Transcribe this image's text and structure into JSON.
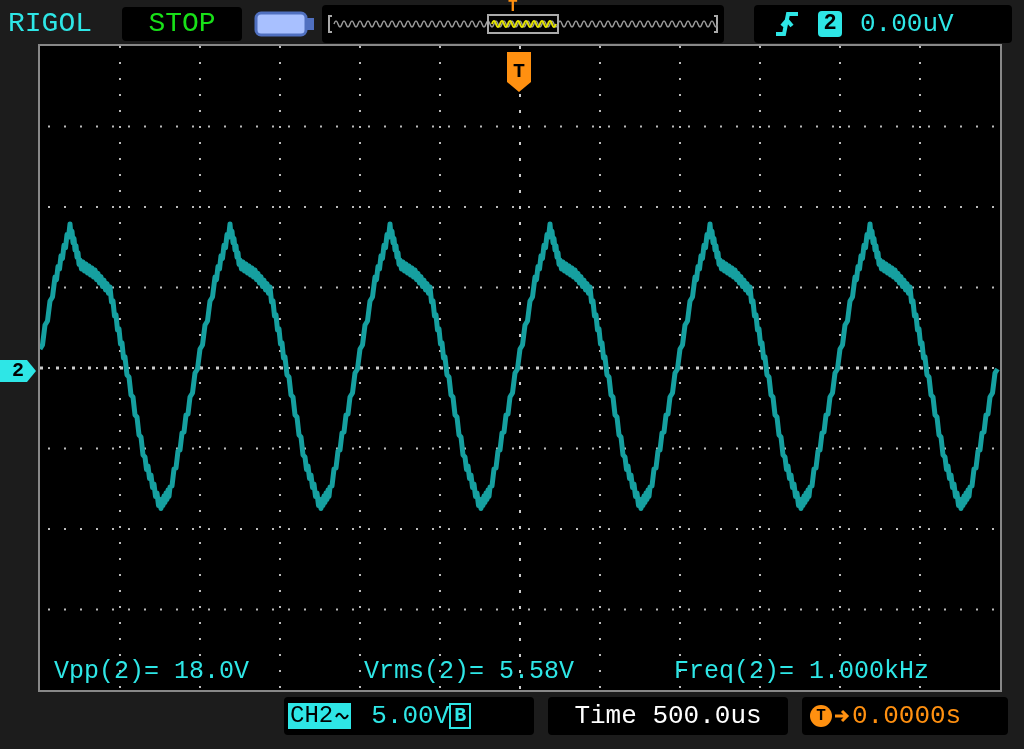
{
  "header": {
    "brand": "RIGOL",
    "run_state": "STOP",
    "timeline_marker": "T",
    "trigger": {
      "channel": "2",
      "level": "0.00uV"
    }
  },
  "screen": {
    "trigger_marker": "T",
    "channel_marker": "2",
    "measurements": [
      {
        "label": "Vpp(2)=",
        "value": "18.0V"
      },
      {
        "label": "Vrms(2)=",
        "value": "5.58V"
      },
      {
        "label": "Freq(2)=",
        "value": "1.000kHz"
      }
    ]
  },
  "footer": {
    "channel": "CH2",
    "scale": "5.00V",
    "bandwidth": "B",
    "timebase": "Time 500.0us",
    "delay_marker": "T",
    "delay": "0.0000s"
  }
}
